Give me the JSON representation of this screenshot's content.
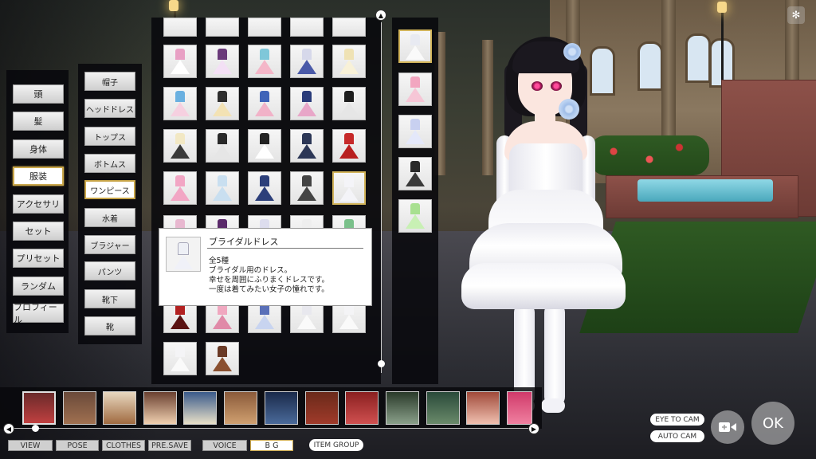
{
  "categories": [
    "頭",
    "髪",
    "身体",
    "服装",
    "アクセサリ",
    "セット",
    "プリセット",
    "ランダム",
    "プロフィール"
  ],
  "active_category_index": 3,
  "subcategories": [
    "帽子",
    "ヘッドドレス",
    "トップス",
    "ボトムス",
    "ワンピース",
    "水着",
    "ブラジャー",
    "パンツ",
    "靴下",
    "靴"
  ],
  "active_subcategory_index": 4,
  "tooltip": {
    "title": "ブライダルドレス",
    "count": "全5種",
    "lines": [
      "ブライダル用のドレス。",
      "幸せを周囲にふりまくドレスです。",
      "一度は着てみたい女子の憧れです。"
    ]
  },
  "bottom_tabs": [
    "VIEW",
    "POSE",
    "CLOTHES",
    "PRE.SAVE",
    "VOICE",
    "B G"
  ],
  "active_bottom_tab_index": 5,
  "item_group_label": "ITEM GROUP",
  "camera": {
    "eye_to_cam": "EYE TO CAM",
    "auto_cam": "AUTO CAM",
    "ok": "OK"
  },
  "icons": {
    "scroll_up": "▲",
    "scroll_left": "◀",
    "scroll_right": "▶",
    "camera": "video-camera-icon",
    "snowflake": "✻"
  },
  "colors": {
    "selection_gold": "#c9a64a",
    "panel_bg": "#08080c",
    "button_gray": "#cfcfcf"
  }
}
